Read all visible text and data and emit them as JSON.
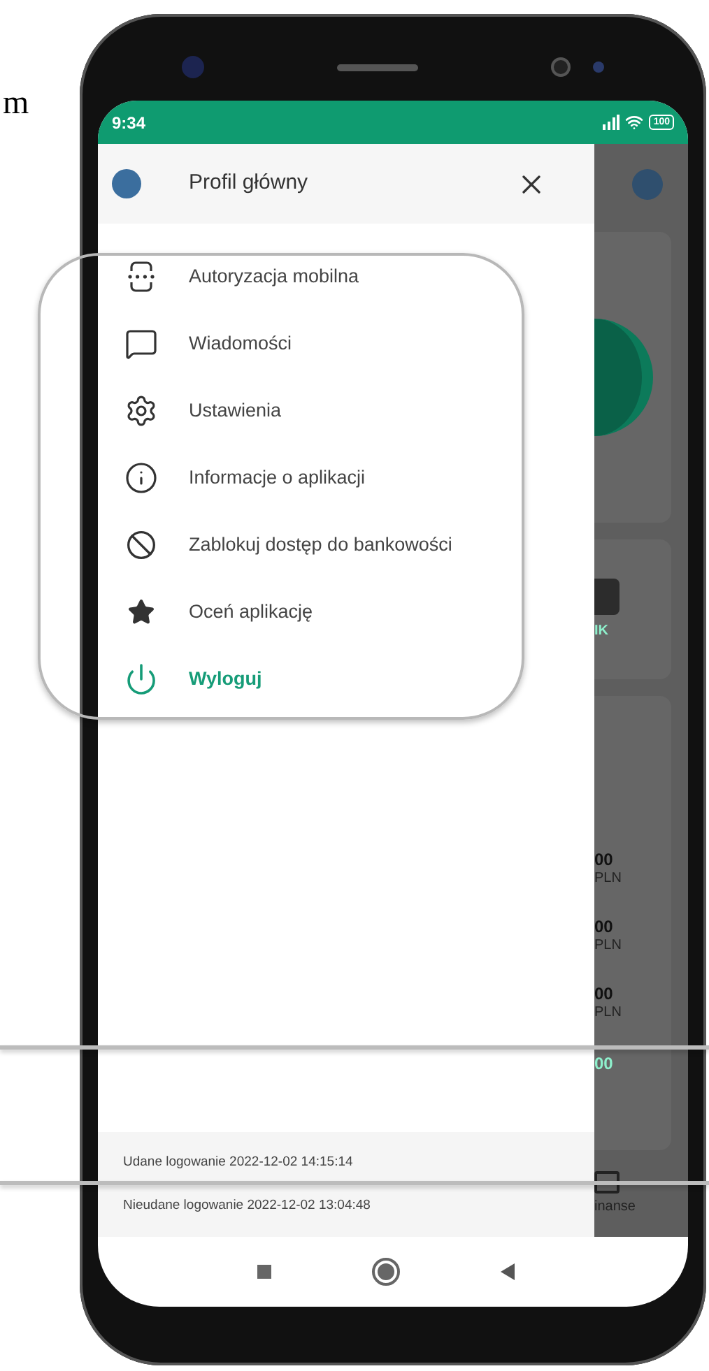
{
  "page_text": "m",
  "status_bar": {
    "time": "9:34",
    "battery": "100"
  },
  "drawer": {
    "title": "Profil główny",
    "items": [
      {
        "kind": "mobile-auth",
        "label": "Autoryzacja mobilna"
      },
      {
        "kind": "messages",
        "label": "Wiadomości"
      },
      {
        "kind": "settings",
        "label": "Ustawienia"
      },
      {
        "kind": "info",
        "label": "Informacje o aplikacji"
      },
      {
        "kind": "block",
        "label": "Zablokuj dostęp do bankowości"
      },
      {
        "kind": "rate",
        "label": "Oceń aplikację"
      },
      {
        "kind": "logout",
        "label": "Wyloguj"
      }
    ],
    "login_history": [
      "Udane logowanie 2022-12-02 14:15:14",
      "Nieudane logowanie 2022-12-02 13:04:48"
    ]
  },
  "background": {
    "shortcut_label": "IK",
    "amounts": [
      {
        "value": "00",
        "currency": "PLN"
      },
      {
        "value": "00",
        "currency": "PLN"
      },
      {
        "value": "00",
        "currency": "PLN"
      }
    ],
    "last_amount": "00",
    "tab_label": "inanse"
  }
}
